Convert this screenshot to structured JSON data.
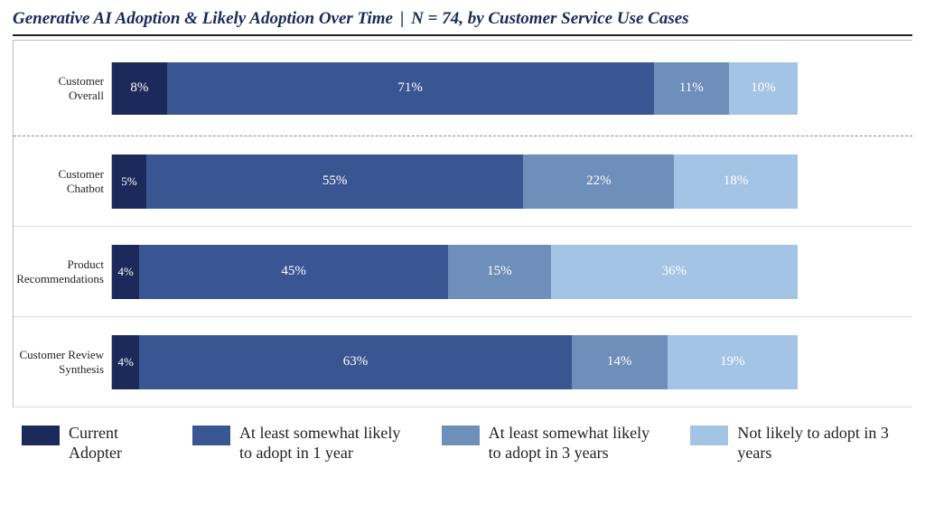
{
  "title": {
    "main": "Generative AI Adoption & Likely Adoption Over Time",
    "separator": "|",
    "sub": "N = 74, by Customer Service Use Cases"
  },
  "legend": [
    {
      "key": "s0",
      "label": "Current Adopter"
    },
    {
      "key": "s1",
      "label": "At least somewhat likely to adopt in 1 year"
    },
    {
      "key": "s2",
      "label": "At least somewhat likely to adopt in 3 years"
    },
    {
      "key": "s3",
      "label": "Not likely to adopt in 3 years"
    }
  ],
  "chart_data": {
    "type": "bar",
    "stacked": true,
    "orientation": "horizontal",
    "title": "Generative AI Adoption & Likely Adoption Over Time | N = 74, by Customer Service Use Cases",
    "xlabel": "",
    "ylabel": "",
    "xlim": [
      0,
      100
    ],
    "unit": "%",
    "categories": [
      "Customer Overall",
      "Customer Chatbot",
      "Product Recommendations",
      "Customer Review Synthesis"
    ],
    "series": [
      {
        "name": "Current Adopter",
        "color": "#1b2a5a",
        "values": [
          8,
          5,
          4,
          4
        ]
      },
      {
        "name": "At least somewhat likely to adopt in 1 year",
        "color": "#3a5692",
        "values": [
          71,
          55,
          45,
          63
        ]
      },
      {
        "name": "At least somewhat likely to adopt in 3 years",
        "color": "#6d8fba",
        "values": [
          11,
          22,
          15,
          14
        ]
      },
      {
        "name": "Not likely to adopt in 3 years",
        "color": "#a3c4e4",
        "values": [
          10,
          18,
          36,
          19
        ]
      }
    ],
    "rows": [
      {
        "label": "Customer Overall",
        "segments": [
          {
            "k": "s0",
            "v": 8
          },
          {
            "k": "s1",
            "v": 71
          },
          {
            "k": "s2",
            "v": 11
          },
          {
            "k": "s3",
            "v": 10
          }
        ]
      },
      {
        "label": "Customer Chatbot",
        "segments": [
          {
            "k": "s0",
            "v": 5
          },
          {
            "k": "s1",
            "v": 55
          },
          {
            "k": "s2",
            "v": 22
          },
          {
            "k": "s3",
            "v": 18
          }
        ]
      },
      {
        "label": "Product Recommendations",
        "segments": [
          {
            "k": "s0",
            "v": 4
          },
          {
            "k": "s1",
            "v": 45
          },
          {
            "k": "s2",
            "v": 15
          },
          {
            "k": "s3",
            "v": 36
          }
        ]
      },
      {
        "label": "Customer Review Synthesis",
        "segments": [
          {
            "k": "s0",
            "v": 4
          },
          {
            "k": "s1",
            "v": 63
          },
          {
            "k": "s2",
            "v": 14
          },
          {
            "k": "s3",
            "v": 19
          }
        ]
      }
    ]
  }
}
